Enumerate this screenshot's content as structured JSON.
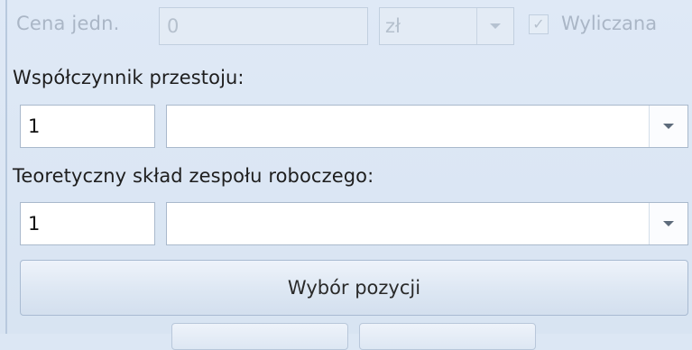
{
  "unit_price_row": {
    "label": "Cena jedn.",
    "value": "0",
    "currency": "zł",
    "calculated_label": "Wyliczana",
    "calculated_checked": true
  },
  "downtime": {
    "label": "Współczynnik przestoju:",
    "value": "1",
    "combo_value": ""
  },
  "crew": {
    "label": "Teoretyczny skład zespołu roboczego:",
    "value": "1",
    "combo_value": ""
  },
  "select_position_button": "Wybór pozycji"
}
